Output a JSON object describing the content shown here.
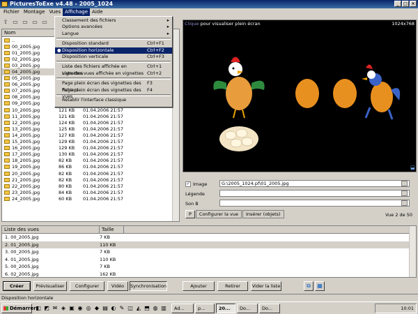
{
  "window": {
    "title": "PicturesToExe v4.48 - 2005_1024"
  },
  "menubar": [
    "Fichier",
    "Montage",
    "Vues",
    "Affichage",
    "Aide"
  ],
  "toolbar_icons": [
    "folder-up-icon",
    "folder-icon",
    "folder-icon",
    "folder-icon",
    "folder-icon"
  ],
  "affichage_menu": {
    "items": [
      {
        "label": "Classement des fichiers",
        "shortcut": "",
        "submenu": true
      },
      {
        "label": "Options avancées",
        "shortcut": "",
        "submenu": true
      },
      {
        "label": "Langue",
        "shortcut": "",
        "submenu": true
      },
      {
        "sep": true
      },
      {
        "label": "Disposition standard",
        "shortcut": "Ctrl+F1"
      },
      {
        "label": "Disposition horizontale",
        "shortcut": "Ctrl+F2",
        "checked": true,
        "highlighted": true
      },
      {
        "label": "Disposition verticale",
        "shortcut": "Ctrl+F3"
      },
      {
        "sep": true
      },
      {
        "label": "Liste des fichiers affichée en vignettes",
        "shortcut": "Ctrl+1"
      },
      {
        "label": "Liste des vues affichée en vignettes",
        "shortcut": "Ctrl+2"
      },
      {
        "sep": true
      },
      {
        "label": "Page plein écran des vignettes des fichiers",
        "shortcut": "F3"
      },
      {
        "label": "Page plein écran des vignettes des vues",
        "shortcut": "F4"
      },
      {
        "sep": true
      },
      {
        "label": "Rétablir l'interface classique",
        "shortcut": ""
      }
    ]
  },
  "file_list": {
    "header": "Nom",
    "rows": [
      {
        "name": "..",
        "size": "",
        "date": ""
      },
      {
        "name": "00_2005.jpg",
        "size": "",
        "date": ""
      },
      {
        "name": "01_2005.jpg",
        "size": "",
        "date": ""
      },
      {
        "name": "02_2005.jpg",
        "size": "",
        "date": ""
      },
      {
        "name": "03_2005.jpg",
        "size": "",
        "date": ""
      },
      {
        "name": "04_2005.jpg",
        "size": "",
        "date": "",
        "selected": true
      },
      {
        "name": "05_2005.jpg",
        "size": "",
        "date": ""
      },
      {
        "name": "06_2005.jpg",
        "size": "",
        "date": ""
      },
      {
        "name": "07_2005.jpg",
        "size": "",
        "date": ""
      },
      {
        "name": "08_2005.jpg",
        "size": "",
        "date": ""
      },
      {
        "name": "09_2005.jpg",
        "size": "121 KB",
        "date": "01.04.2006 21:57"
      },
      {
        "name": "10_2005.jpg",
        "size": "121 KB",
        "date": "01.04.2006 21:57"
      },
      {
        "name": "11_2005.jpg",
        "size": "121 KB",
        "date": "01.04.2006 21:57"
      },
      {
        "name": "12_2005.jpg",
        "size": "124 KB",
        "date": "01.04.2006 21:57"
      },
      {
        "name": "13_2005.jpg",
        "size": "125 KB",
        "date": "01.04.2006 21:57"
      },
      {
        "name": "14_2005.jpg",
        "size": "127 KB",
        "date": "01.04.2006 21:57"
      },
      {
        "name": "15_2005.jpg",
        "size": "129 KB",
        "date": "01.04.2006 21:57"
      },
      {
        "name": "16_2005.jpg",
        "size": "129 KB",
        "date": "01.04.2006 21:57"
      },
      {
        "name": "17_2005.jpg",
        "size": "130 KB",
        "date": "01.04.2006 21:57"
      },
      {
        "name": "18_2005.jpg",
        "size": "82 KB",
        "date": "01.04.2006 21:57"
      },
      {
        "name": "19_2005.jpg",
        "size": "86 KB",
        "date": "01.04.2006 21:57"
      },
      {
        "name": "20_2005.jpg",
        "size": "82 KB",
        "date": "01.04.2006 21:57"
      },
      {
        "name": "21_2005.jpg",
        "size": "82 KB",
        "date": "01.04.2006 21:57"
      },
      {
        "name": "22_2005.jpg",
        "size": "80 KB",
        "date": "01.04.2006 21:57"
      },
      {
        "name": "23_2005.jpg",
        "size": "84 KB",
        "date": "01.04.2006 21:57"
      },
      {
        "name": "24_2005.jpg",
        "size": "60 KB",
        "date": "01.04.2006 21:57"
      }
    ]
  },
  "preview": {
    "hint_link": "Clique",
    "hint_text": " pour visualiser plein écran",
    "resolution": "1024x768"
  },
  "properties": {
    "image_label": "Image",
    "image_path": "G:\\2005_1024.pf\\01_2005.jpg",
    "legende_label": "Légende",
    "legende_value": "",
    "son_label": "Son B",
    "son_value": "",
    "tabs": [
      "P",
      "Configurer la vue",
      "Insérer (objets)"
    ],
    "vue_info": "Vue 2 de 50"
  },
  "views_list": {
    "col_name": "Liste des vues",
    "col_size": "Taille",
    "rows": [
      {
        "name": "1. 00_2005.jpg",
        "size": "7 KB"
      },
      {
        "name": "2. 01_2005.jpg",
        "size": "110 KB",
        "selected": true
      },
      {
        "name": "3. 00_2005.jpg",
        "size": "7 KB"
      },
      {
        "name": "4. 01_2005.jpg",
        "size": "110 KB"
      },
      {
        "name": "5. 00_2005.jpg",
        "size": "7 KB"
      },
      {
        "name": "6. 02_2005.jpg",
        "size": "162 KB"
      }
    ]
  },
  "buttons": {
    "creer": "Créer",
    "previsualiser": "Prévisualiser",
    "configurer": "Configurer",
    "video": "Vidéo",
    "synchronisation": "Synchronisation",
    "ajouter": "Ajouter",
    "retirer": "Retirer",
    "vider": "Vider la liste"
  },
  "status": {
    "text": "Disposition horizontale"
  },
  "taskbar": {
    "start": "Démarrer",
    "tasks": [
      "Ad...",
      "p...",
      "20...",
      "Do...",
      "Do..."
    ],
    "clock": "10:01"
  }
}
